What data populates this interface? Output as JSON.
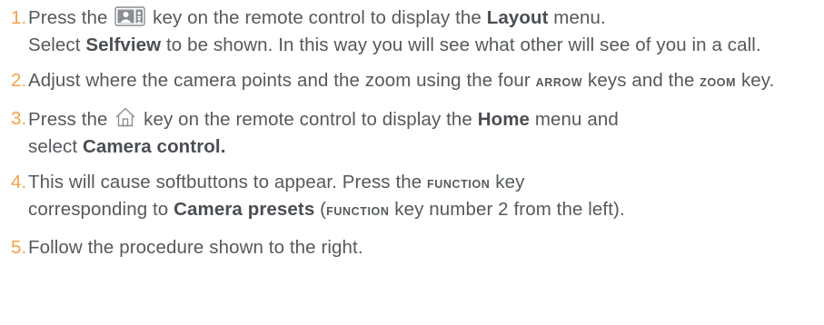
{
  "steps": [
    {
      "number": "1.",
      "parts": [
        "Press the",
        "key on the remote control to display the",
        "Layout",
        "menu.",
        "Select",
        "Selfview",
        "to be shown. In this way you will see what other will see of you in a call."
      ],
      "icon": "layout-key-icon"
    },
    {
      "number": "2.",
      "parts": [
        "Adjust where the camera points and the zoom using the four",
        "arrow",
        "keys and the",
        "zoom",
        "key."
      ]
    },
    {
      "number": "3.",
      "parts": [
        "Press the",
        "key on the remote control to display the",
        "Home",
        "menu and",
        "select",
        "Camera control."
      ],
      "icon": "home-key-icon"
    },
    {
      "number": "4.",
      "parts": [
        "This will cause softbuttons to appear. Press the",
        "function",
        "key",
        "corresponding to",
        "Camera presets",
        "(",
        "function",
        "key number 2 from the left)."
      ]
    },
    {
      "number": "5.",
      "parts": [
        "Follow the procedure shown to the right."
      ]
    }
  ],
  "colors": {
    "number": "#f4a24a",
    "text": "#55595c",
    "icon": "#8a8e92"
  }
}
